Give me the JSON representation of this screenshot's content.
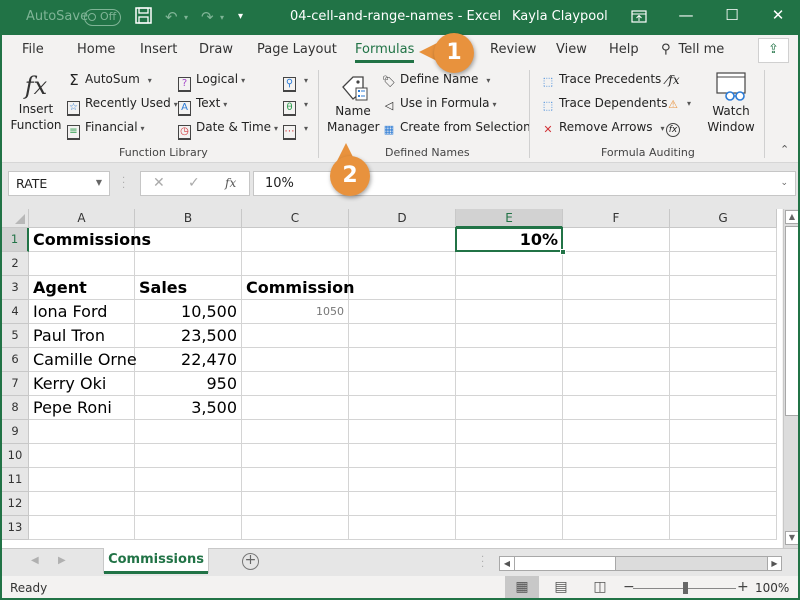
{
  "titlebar": {
    "autosave_label": "AutoSave",
    "autosave_state": "Off",
    "document_title": "04-cell-and-range-names  -  Excel",
    "user_name": "Kayla Claypool",
    "icons": [
      "save-icon",
      "undo-icon",
      "redo-icon",
      "customize-qat-icon",
      "ribbon-display-icon",
      "minimize-icon",
      "maximize-icon",
      "close-icon"
    ]
  },
  "tabs": [
    {
      "label": "File",
      "active": false
    },
    {
      "label": "Home",
      "active": false
    },
    {
      "label": "Insert",
      "active": false
    },
    {
      "label": "Draw",
      "active": false
    },
    {
      "label": "Page Layout",
      "active": false
    },
    {
      "label": "Formulas",
      "active": true
    },
    {
      "label": "Review",
      "active": false
    },
    {
      "label": "View",
      "active": false
    },
    {
      "label": "Help",
      "active": false
    }
  ],
  "tell_me": "Tell me",
  "ribbon": {
    "function_library": {
      "label": "Function Library",
      "insert_function": [
        "Insert",
        "Function"
      ],
      "autosum": "AutoSum",
      "recently_used": "Recently Used",
      "financial": "Financial",
      "logical": "Logical",
      "text": "Text",
      "date_time": "Date & Time"
    },
    "defined_names": {
      "label": "Defined Names",
      "name_manager": [
        "Name",
        "Manager"
      ],
      "define_name": "Define Name",
      "use_in_formula": "Use in Formula",
      "create_from_selection": "Create from Selection"
    },
    "formula_auditing": {
      "label": "Formula Auditing",
      "trace_precedents": "Trace Precedents",
      "trace_dependents": "Trace Dependents",
      "remove_arrows": "Remove Arrows",
      "watch_window": [
        "Watch",
        "Window"
      ]
    }
  },
  "formula_bar": {
    "name_box": "RATE",
    "formula": "10%"
  },
  "columns": [
    "A",
    "B",
    "C",
    "D",
    "E",
    "F",
    "G"
  ],
  "rows": [
    "1",
    "2",
    "3",
    "4",
    "5",
    "6",
    "7",
    "8",
    "9",
    "10",
    "11",
    "12",
    "13"
  ],
  "selected_cell": "E1",
  "cells": {
    "A1": "Commissions",
    "A3": "Agent",
    "B3": "Sales",
    "C3": "Commission",
    "A4": "Iona Ford",
    "B4": "10,500",
    "C4": "1050",
    "A5": "Paul Tron",
    "B5": "23,500",
    "A6": "Camille Orne",
    "B6": "22,470",
    "A7": "Kerry Oki",
    "B7": "950",
    "A8": "Pepe Roni",
    "B8": "3,500",
    "E1": "10%"
  },
  "sheet_tabs": [
    {
      "label": "Commissions",
      "active": true
    }
  ],
  "status": {
    "mode": "Ready",
    "zoom": "100%",
    "zoom_level_percent": 100
  },
  "callouts": [
    "1",
    "2"
  ],
  "colors": {
    "brand": "#217346",
    "callout": "#e8923d"
  }
}
